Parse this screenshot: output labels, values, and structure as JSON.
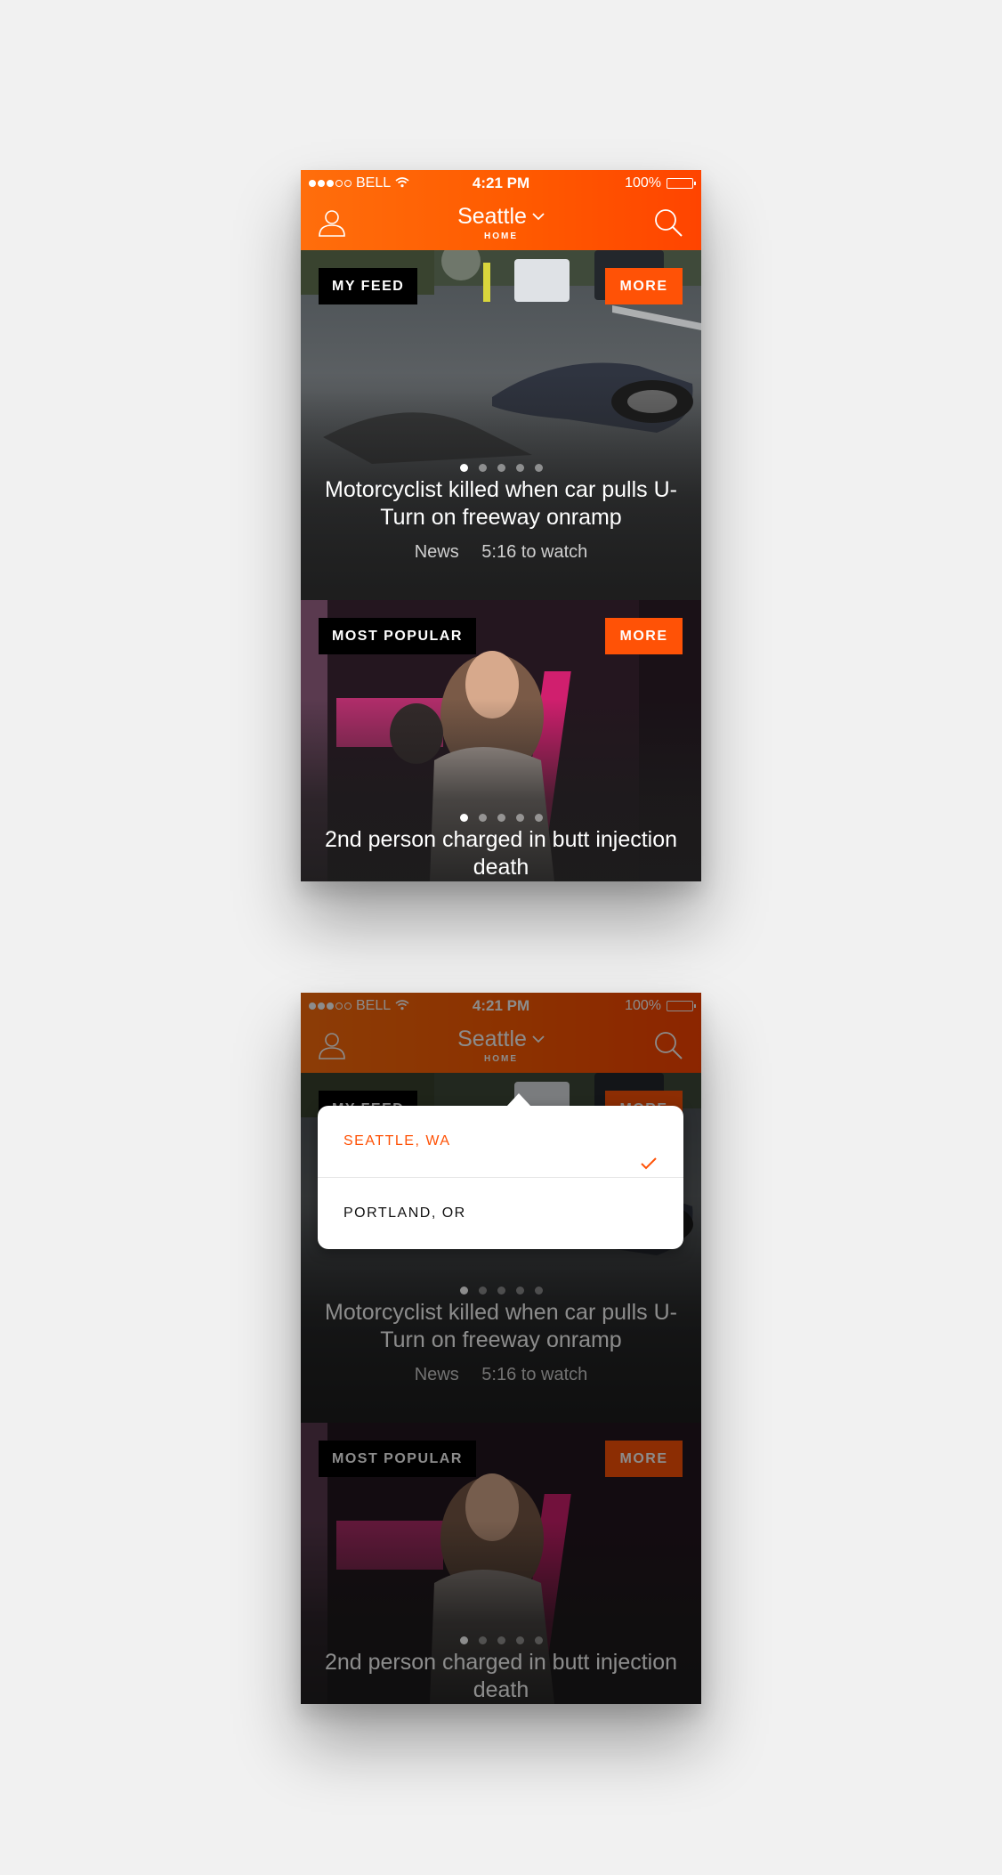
{
  "status_bar": {
    "carrier": "BELL",
    "time": "4:21 PM",
    "battery": "100%"
  },
  "header": {
    "city": "Seattle",
    "subtitle": "HOME"
  },
  "feed_card": {
    "tag": "MY FEED",
    "more_label": "MORE",
    "headline": "Motorcyclist killed when car pulls U-Turn on freeway onramp",
    "category": "News",
    "duration": "5:16 to watch",
    "pager_count": 5,
    "pager_active": 1
  },
  "popular_card": {
    "tag": "MOST POPULAR",
    "more_label": "MORE",
    "headline": "2nd person charged in butt injection death",
    "pager_count": 5,
    "pager_active": 1
  },
  "city_dropdown": {
    "options": [
      {
        "label": "SEATTLE, WA",
        "selected": true
      },
      {
        "label": "PORTLAND, OR",
        "selected": false
      }
    ]
  },
  "colors": {
    "accent": "#ff5206",
    "header_start": "#ff6e0c",
    "header_end": "#ff4400",
    "tag_bg": "#000000"
  },
  "icons": [
    "signal-dots-icon",
    "wifi-icon",
    "battery-icon",
    "profile-icon",
    "chevron-down-icon",
    "search-icon",
    "check-icon"
  ]
}
